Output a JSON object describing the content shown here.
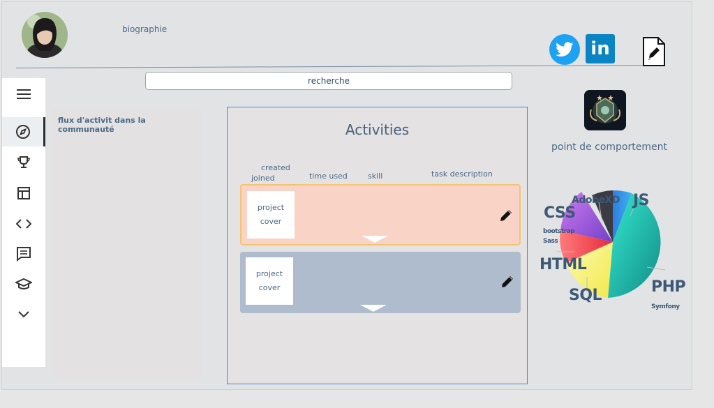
{
  "header": {
    "bio_label": "biographie",
    "search_label": "recherche"
  },
  "social": {
    "linkedin_text": "in"
  },
  "sidebar": {
    "items": [
      {
        "icon": "menu-icon"
      },
      {
        "icon": "compass-icon",
        "active": true
      },
      {
        "icon": "trophy-icon"
      },
      {
        "icon": "dashboard-icon"
      },
      {
        "icon": "code-icon"
      },
      {
        "icon": "comment-icon"
      },
      {
        "icon": "graduation-cap-icon"
      },
      {
        "icon": "chevron-down-icon"
      }
    ]
  },
  "feed": {
    "title": "flux d'activit dans la communauté"
  },
  "activities": {
    "title": "Activities",
    "columns": {
      "created": "created",
      "joined": "joined",
      "time_used": "time used",
      "skill": "skill",
      "task_description": "task description"
    },
    "cards": [
      {
        "cover_line1": "project",
        "cover_line2": "cover",
        "bg": "#f8d3c6",
        "border": "#f3c572"
      },
      {
        "cover_line1": "project",
        "cover_line2": "cover",
        "bg": "#aebcce",
        "border": null
      }
    ]
  },
  "profile": {
    "behavior_points_label": "point de comportement"
  },
  "skills_chart": {
    "labels": {
      "css": "CSS",
      "adobexd": "AdobeXD",
      "js": "JS",
      "bootstrap": "bootstrap",
      "sass": "Sass",
      "html": "HTML",
      "sql": "SQL",
      "php": "PHP",
      "symfony": "Symfony"
    }
  },
  "colors": {
    "accent_text": "#4a6a86",
    "twitter": "#1da1f2",
    "linkedin": "#0a85c3",
    "activities_border": "#4b83d6"
  }
}
